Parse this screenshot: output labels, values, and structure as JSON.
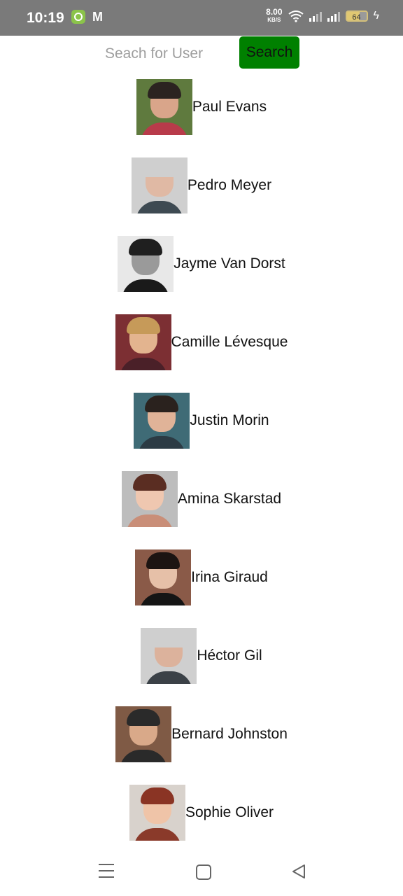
{
  "status_bar": {
    "time": "10:19",
    "speed_value": "8.00",
    "speed_unit": "KB/S",
    "battery": "64"
  },
  "search": {
    "placeholder": "Seach for User",
    "button_label": "Search",
    "button_color": "#008000"
  },
  "users": [
    {
      "name": "Paul Evans"
    },
    {
      "name": "Pedro Meyer"
    },
    {
      "name": "Jayme Van Dorst"
    },
    {
      "name": "Camille Lévesque"
    },
    {
      "name": "Justin Morin"
    },
    {
      "name": "Amina Skarstad"
    },
    {
      "name": "Irina Giraud"
    },
    {
      "name": "Héctor Gil"
    },
    {
      "name": "Bernard Johnston"
    },
    {
      "name": "Sophie Oliver"
    }
  ],
  "nav": {
    "icons": [
      "menu-icon",
      "home-icon",
      "back-icon"
    ]
  }
}
